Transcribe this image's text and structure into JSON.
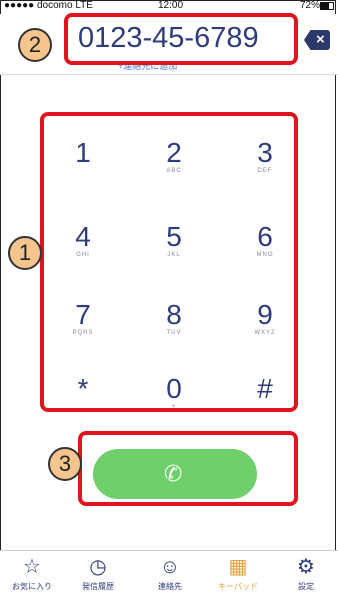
{
  "status_bar": {
    "carrier": "●●●●● docomo LTE",
    "time": "12:00",
    "battery": "72%"
  },
  "phone_number": "0123-45-6789",
  "add_contact_link": "+連絡先に追加",
  "backspace_label": "×",
  "keypad": [
    {
      "digit": "1",
      "letters": ""
    },
    {
      "digit": "2",
      "letters": "ABC"
    },
    {
      "digit": "3",
      "letters": "DEF"
    },
    {
      "digit": "4",
      "letters": "GHI"
    },
    {
      "digit": "5",
      "letters": "JKL"
    },
    {
      "digit": "6",
      "letters": "MNO"
    },
    {
      "digit": "7",
      "letters": "PQRS"
    },
    {
      "digit": "8",
      "letters": "TUV"
    },
    {
      "digit": "9",
      "letters": "WXYZ"
    },
    {
      "digit": "*",
      "letters": ""
    },
    {
      "digit": "0",
      "letters": "+"
    },
    {
      "digit": "#",
      "letters": ""
    }
  ],
  "call_icon": "phone-icon",
  "annotations": {
    "one": "1",
    "two": "2",
    "three": "3"
  },
  "tabs": [
    {
      "label": "お気に入り",
      "icon": "☆",
      "active": false
    },
    {
      "label": "発信履歴",
      "icon": "◷",
      "active": false
    },
    {
      "label": "連絡先",
      "icon": "☺",
      "active": false
    },
    {
      "label": "キーパッド",
      "icon": "▦",
      "active": true
    },
    {
      "label": "設定",
      "icon": "⚙",
      "active": false
    }
  ],
  "colors": {
    "accent": "#2f3c7a",
    "call_green": "#6fcf6b",
    "annotation_red": "#e0141e",
    "active_tab": "#e6a23c"
  }
}
